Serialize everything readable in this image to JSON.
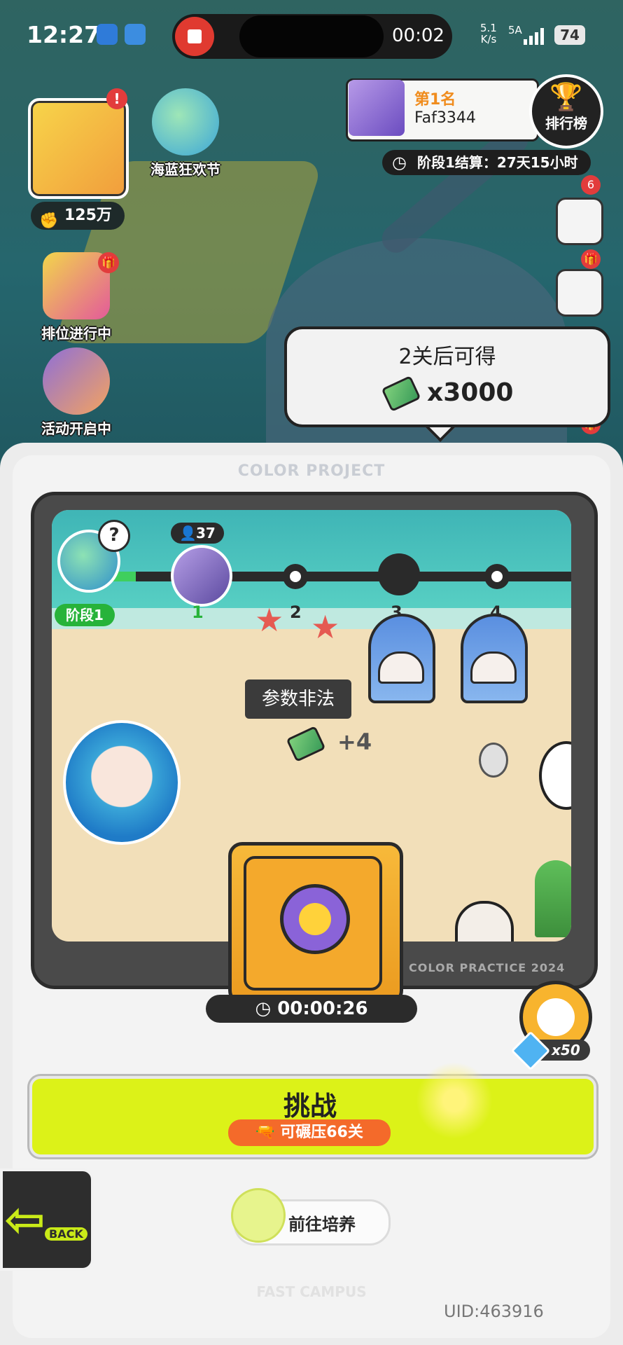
{
  "status_bar": {
    "time": "12:27",
    "recording_time": "00:02",
    "net_speed_top": "5.1",
    "net_speed_unit": "K/s",
    "signal_label": "5A",
    "battery": "74"
  },
  "top_left": {
    "power_value": "125万",
    "events": [
      {
        "label": "海蓝狂欢节",
        "icon": "beach-carnival-icon"
      },
      {
        "label": "排位进行中",
        "icon": "ranked-icon"
      },
      {
        "label": "活动开启中",
        "icon": "event-icon"
      }
    ],
    "avatar_badge": "!"
  },
  "leaderboard": {
    "rank": "第1名",
    "player_name": "Faf3344",
    "button_label": "排行榜",
    "stage_settlement": "阶段1结算：27天15小时"
  },
  "side_buttons": [
    {
      "icon": "pig-icon",
      "badge": "6"
    },
    {
      "icon": "checklist-icon",
      "badge": "gift"
    },
    {
      "icon": "mail-icon",
      "badge": "gift"
    }
  ],
  "tooltip": {
    "title": "2关后可得",
    "reward_icon": "cash-icon",
    "reward_amount": "x3000"
  },
  "panel": {
    "header": "COLOR PROJECT",
    "watermark": "COLOR PRACTICE 2024",
    "footer_mark": "FAST CAMPUS"
  },
  "map": {
    "player_count": "37",
    "stage_label": "阶段1",
    "nodes": [
      "1",
      "2",
      "3",
      "4"
    ],
    "error_tip": "参数非法",
    "cash_mark": "+4"
  },
  "safe": {
    "timer": "00:00:26"
  },
  "alarm": {
    "cost": "x50",
    "cost_icon": "diamond-icon"
  },
  "challenge": {
    "label": "挑战",
    "sub_label": "可碾压66关"
  },
  "back": {
    "label": "BACK"
  },
  "train": {
    "label": "前往培养"
  },
  "uid": "UID:463916"
}
